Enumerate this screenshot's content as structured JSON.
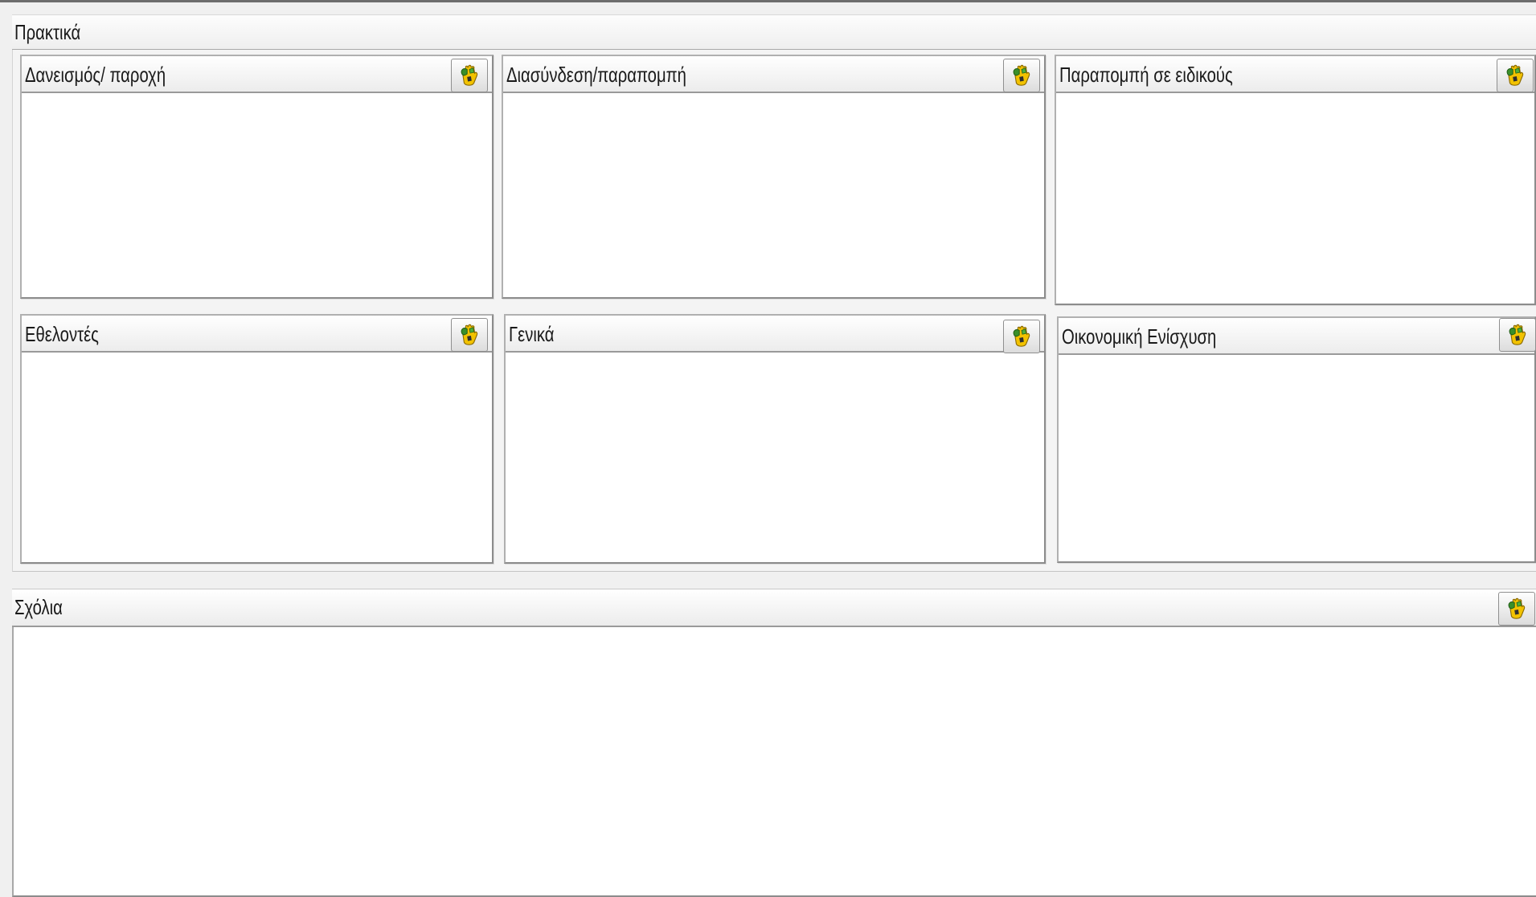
{
  "section": {
    "title": "Πρακτικά"
  },
  "panels": [
    {
      "title": "Δανεισμός/ παροχή",
      "icon": "hand-icon"
    },
    {
      "title": "Διασύνδεση/παραπομπή",
      "icon": "hand-icon"
    },
    {
      "title": "Παραπομπή σε ειδικούς",
      "icon": "hand-icon"
    },
    {
      "title": "Εθελοντές",
      "icon": "hand-icon"
    },
    {
      "title": "Γενικά",
      "icon": "hand-icon"
    },
    {
      "title": "Οικονομική Ενίσχυση",
      "icon": "hand-icon"
    }
  ],
  "comments": {
    "title": "Σχόλια",
    "icon": "hand-icon"
  },
  "colors": {
    "window_bg": "#f0f0f0",
    "panel_border": "#8c8c8c",
    "icon_green": "#3a8f2a",
    "icon_yellow": "#f2c200"
  }
}
